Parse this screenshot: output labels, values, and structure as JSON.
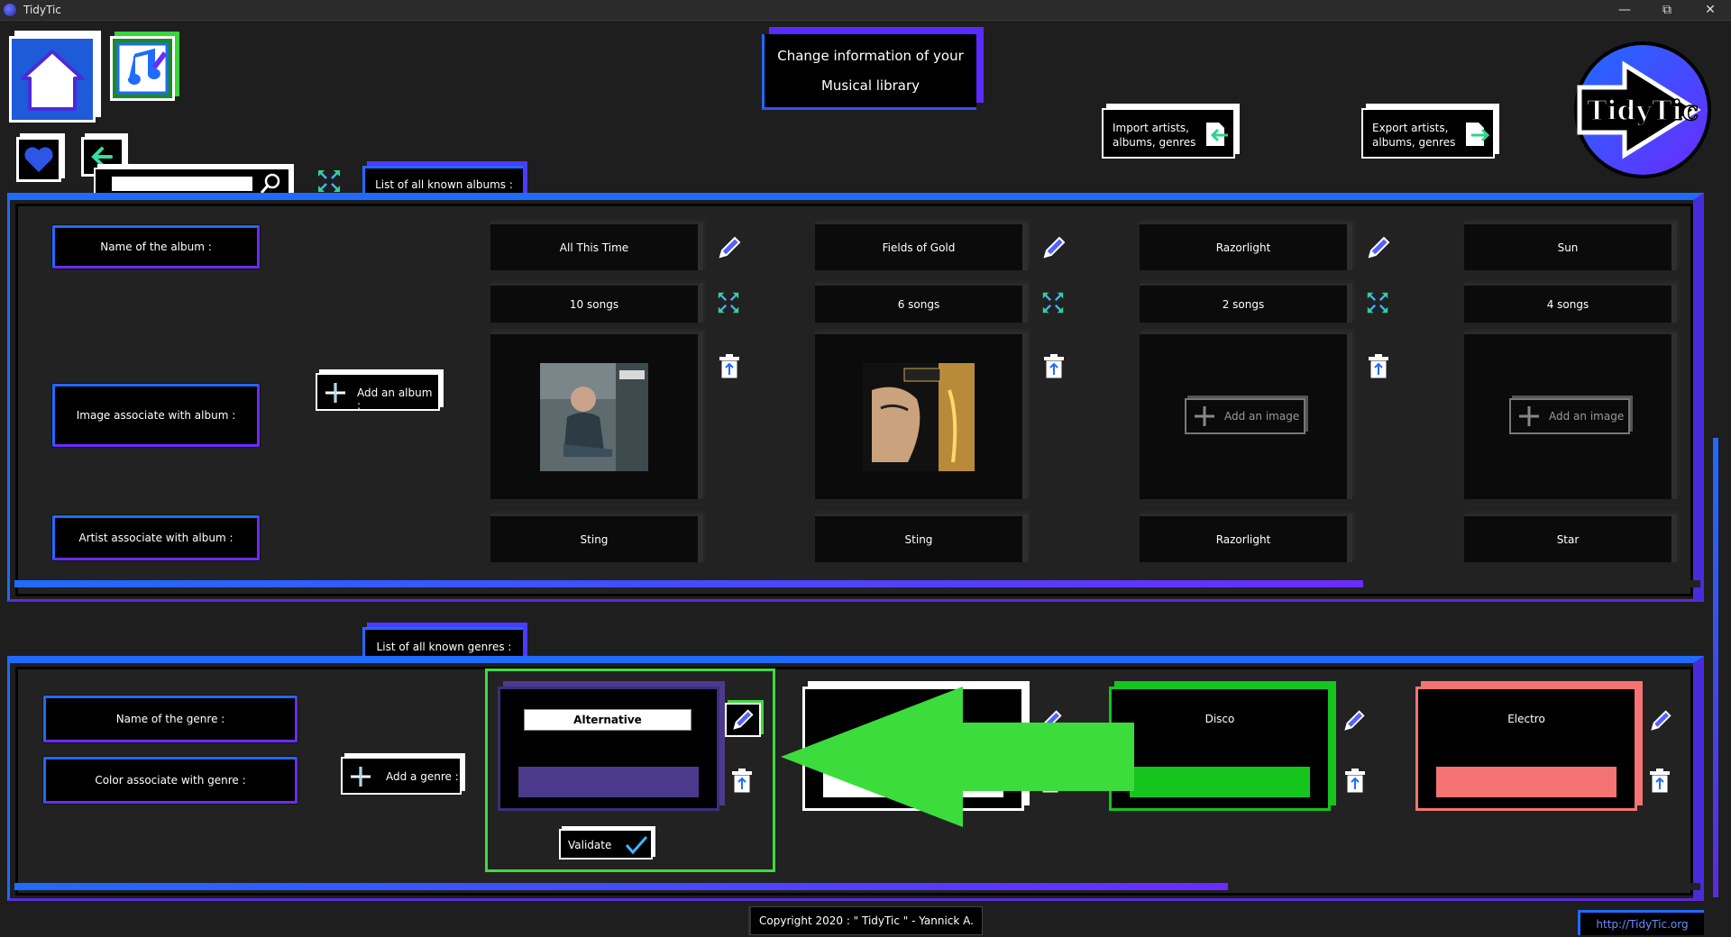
{
  "window": {
    "title": "TidyTic"
  },
  "header": {
    "title_line1": "Change information of your",
    "title_line2": "Musical library",
    "import_label": "Import artists, albums, genres",
    "export_label": "Export artists, albums, genres",
    "logo_text": "TidyTic"
  },
  "search": {
    "value": "",
    "placeholder": ""
  },
  "albums_section": {
    "heading": "List of all known albums :",
    "row_labels": {
      "name": "Name of the album :",
      "image": "Image associate with album :",
      "artist": "Artist associate with album :"
    },
    "add_label": "Add an album :",
    "add_image_label": "Add an image",
    "items": [
      {
        "name": "All This Time",
        "songs": "10 songs",
        "artist": "Sting",
        "has_image": true
      },
      {
        "name": "Fields of Gold",
        "songs": "6 songs",
        "artist": "Sting",
        "has_image": true
      },
      {
        "name": "Razorlight",
        "songs": "2 songs",
        "artist": "Razorlight",
        "has_image": false
      },
      {
        "name": "Sun",
        "songs": "4 songs",
        "artist": "Star",
        "has_image": false
      }
    ],
    "scroll_fraction": 0.8
  },
  "genres_section": {
    "heading": "List of all known genres :",
    "row_labels": {
      "name": "Name of the genre :",
      "color": "Color associate with genre :"
    },
    "add_label": "Add a genre :",
    "validate_label": "Validate",
    "items": [
      {
        "name": "Alternative",
        "color": "#4b3a8c",
        "editing": true
      },
      {
        "name": "",
        "color": "#ffffff",
        "editing": false
      },
      {
        "name": "Disco",
        "color": "#16c41e",
        "editing": false
      },
      {
        "name": "Electro",
        "color": "#f57373",
        "editing": false
      }
    ],
    "scroll_fraction": 0.72
  },
  "footer": {
    "copyright": "Copyright 2020 : \" TidyTic \" - Yannick A.",
    "link": "http://TidyTic.org"
  },
  "colors": {
    "accent_blue": "#1f6bff",
    "accent_purple": "#6a2bff",
    "highlight_green": "#3ddc3d"
  }
}
